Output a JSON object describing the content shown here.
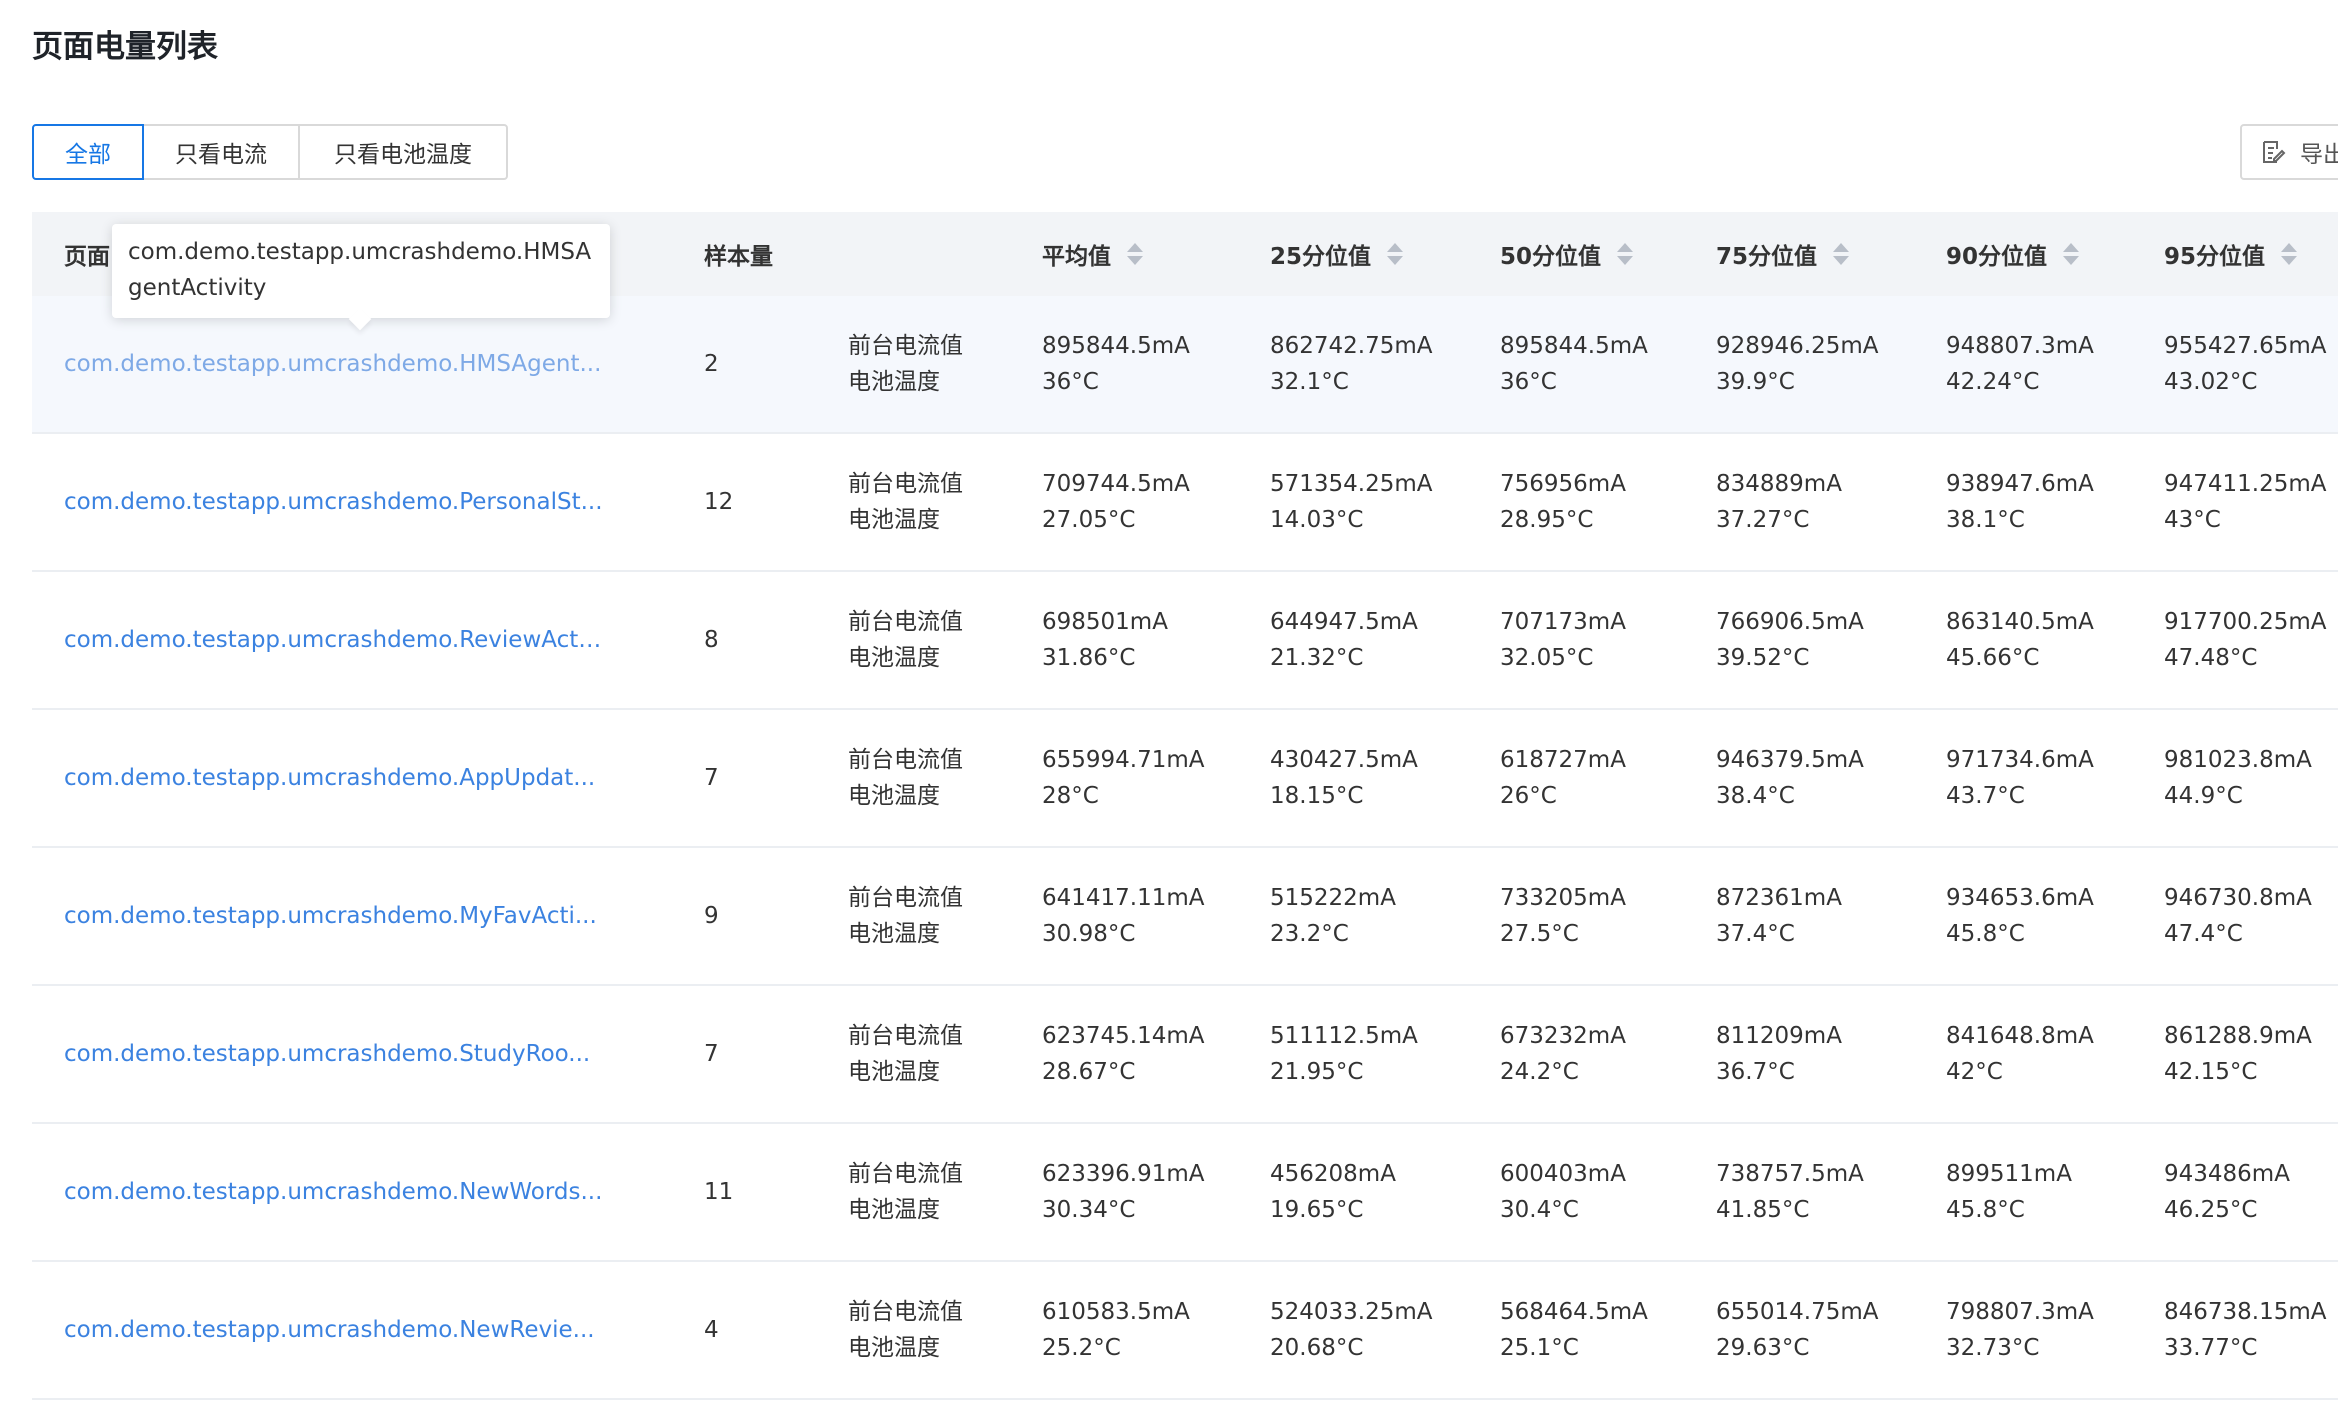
{
  "page": {
    "title": "页面电量列表"
  },
  "filters": [
    {
      "label": "全部",
      "active": true
    },
    {
      "label": "只看电流",
      "active": false
    },
    {
      "label": "只看电池温度",
      "active": false
    }
  ],
  "export": {
    "label": "导出"
  },
  "table": {
    "headers": {
      "page": "页面",
      "samples": "样本量",
      "avg": "平均值",
      "p25": "25分位值",
      "p50": "50分位值",
      "p75": "75分位值",
      "p90": "90分位值",
      "p95": "95分位值"
    },
    "metric_labels": [
      "前台电流值",
      "电池温度"
    ],
    "rows": [
      {
        "page": "com.demo.testapp.umcrashdemo.HMSAgent...",
        "samples": "2",
        "avg": [
          "895844.5mA",
          "36°C"
        ],
        "p25": [
          "862742.75mA",
          "32.1°C"
        ],
        "p50": [
          "895844.5mA",
          "36°C"
        ],
        "p75": [
          "928946.25mA",
          "39.9°C"
        ],
        "p90": [
          "948807.3mA",
          "42.24°C"
        ],
        "p95": [
          "955427.65mA",
          "43.02°C"
        ]
      },
      {
        "page": "com.demo.testapp.umcrashdemo.PersonalSt...",
        "samples": "12",
        "avg": [
          "709744.5mA",
          "27.05°C"
        ],
        "p25": [
          "571354.25mA",
          "14.03°C"
        ],
        "p50": [
          "756956mA",
          "28.95°C"
        ],
        "p75": [
          "834889mA",
          "37.27°C"
        ],
        "p90": [
          "938947.6mA",
          "38.1°C"
        ],
        "p95": [
          "947411.25mA",
          "43°C"
        ]
      },
      {
        "page": "com.demo.testapp.umcrashdemo.ReviewActi...",
        "samples": "8",
        "avg": [
          "698501mA",
          "31.86°C"
        ],
        "p25": [
          "644947.5mA",
          "21.32°C"
        ],
        "p50": [
          "707173mA",
          "32.05°C"
        ],
        "p75": [
          "766906.5mA",
          "39.52°C"
        ],
        "p90": [
          "863140.5mA",
          "45.66°C"
        ],
        "p95": [
          "917700.25mA",
          "47.48°C"
        ]
      },
      {
        "page": "com.demo.testapp.umcrashdemo.AppUpdat...",
        "samples": "7",
        "avg": [
          "655994.71mA",
          "28°C"
        ],
        "p25": [
          "430427.5mA",
          "18.15°C"
        ],
        "p50": [
          "618727mA",
          "26°C"
        ],
        "p75": [
          "946379.5mA",
          "38.4°C"
        ],
        "p90": [
          "971734.6mA",
          "43.7°C"
        ],
        "p95": [
          "981023.8mA",
          "44.9°C"
        ]
      },
      {
        "page": "com.demo.testapp.umcrashdemo.MyFavActi...",
        "samples": "9",
        "avg": [
          "641417.11mA",
          "30.98°C"
        ],
        "p25": [
          "515222mA",
          "23.2°C"
        ],
        "p50": [
          "733205mA",
          "27.5°C"
        ],
        "p75": [
          "872361mA",
          "37.4°C"
        ],
        "p90": [
          "934653.6mA",
          "45.8°C"
        ],
        "p95": [
          "946730.8mA",
          "47.4°C"
        ]
      },
      {
        "page": "com.demo.testapp.umcrashdemo.StudyRoo...",
        "samples": "7",
        "avg": [
          "623745.14mA",
          "28.67°C"
        ],
        "p25": [
          "511112.5mA",
          "21.95°C"
        ],
        "p50": [
          "673232mA",
          "24.2°C"
        ],
        "p75": [
          "811209mA",
          "36.7°C"
        ],
        "p90": [
          "841648.8mA",
          "42°C"
        ],
        "p95": [
          "861288.9mA",
          "42.15°C"
        ]
      },
      {
        "page": "com.demo.testapp.umcrashdemo.NewWords...",
        "samples": "11",
        "avg": [
          "623396.91mA",
          "30.34°C"
        ],
        "p25": [
          "456208mA",
          "19.65°C"
        ],
        "p50": [
          "600403mA",
          "30.4°C"
        ],
        "p75": [
          "738757.5mA",
          "41.85°C"
        ],
        "p90": [
          "899511mA",
          "45.8°C"
        ],
        "p95": [
          "943486mA",
          "46.25°C"
        ]
      },
      {
        "page": "com.demo.testapp.umcrashdemo.NewRevie...",
        "samples": "4",
        "avg": [
          "610583.5mA",
          "25.2°C"
        ],
        "p25": [
          "524033.25mA",
          "20.68°C"
        ],
        "p50": [
          "568464.5mA",
          "25.1°C"
        ],
        "p75": [
          "655014.75mA",
          "29.63°C"
        ],
        "p90": [
          "798807.3mA",
          "32.73°C"
        ],
        "p95": [
          "846738.15mA",
          "33.77°C"
        ]
      }
    ]
  },
  "tooltip": {
    "text": "com.demo.testapp.umcrashdemo.HMSAgentActivity"
  },
  "colors": {
    "accent": "#1677e5",
    "link": "#3b82e0",
    "header_bg": "#f2f4f7"
  },
  "icons": {
    "export": "export-doc-icon",
    "sort": "sort-icon"
  }
}
